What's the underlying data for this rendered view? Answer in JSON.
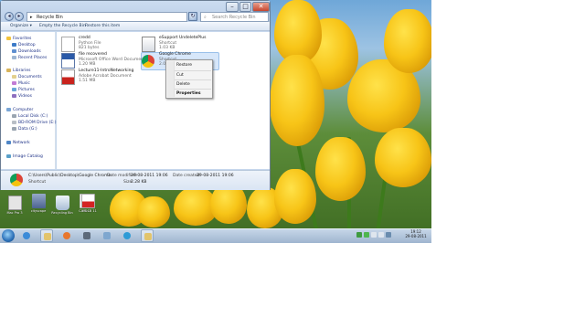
{
  "window": {
    "address": "Recycle Bin",
    "address_arrow": "▸",
    "search_placeholder": "Search Recycle Bin",
    "caption_minimize": "–",
    "caption_maximize": "□",
    "caption_close": "✕"
  },
  "toolbar": {
    "organize": "Organize ▾",
    "empty": "Empty the Recycle Bin",
    "restore": "Restore this item"
  },
  "navpane": {
    "favorites": "Favorites",
    "desktop": "Desktop",
    "downloads": "Downloads",
    "recent": "Recent Places",
    "libraries": "Libraries",
    "documents": "Documents",
    "music": "Music",
    "pictures": "Pictures",
    "videos": "Videos",
    "computer": "Computer",
    "local_disk": "Local Disk (C:)",
    "bdrom": "BD-ROM Drive (E:) 4:",
    "data": "Data (G:)",
    "network": "Network",
    "image_catalog": "Image Catalog"
  },
  "files": [
    {
      "name": "credd",
      "type": "Python File",
      "size": "821 bytes"
    },
    {
      "name": "eSupport UndeletePlus",
      "type": "Shortcut",
      "size": "1.03 KB"
    },
    {
      "name": "file recovered",
      "type": "Microsoft Office Word Document",
      "size": "1.20 MB"
    },
    {
      "name": "Google Chrome",
      "type": "Shortcut",
      "size": "2.00"
    },
    {
      "name": "Lecture11-IntroNetworking",
      "type": "Adobe Acrobat Document",
      "size": "1.51 MB"
    }
  ],
  "context_menu": {
    "restore": "Restore",
    "cut": "Cut",
    "delete": "Delete",
    "properties": "Properties"
  },
  "details": {
    "path": "C:\\Users\\Public\\Desktop\\Google Chrome",
    "type": "Shortcut",
    "date_modified_label": "Date modified:",
    "date_modified": "29-08-2011 19:06",
    "size_label": "Size:",
    "size": "2.28 KB",
    "date_created_label": "Date created:",
    "date_created": "29-08-2011 19:06"
  },
  "desktop_icons": [
    {
      "label": "Mac Pro 3",
      "color": "#d9d9d9"
    },
    {
      "label": "cityscape",
      "color": "#7a8fb3"
    },
    {
      "label": "Recycling Bin",
      "color": "#c8d6e6"
    },
    {
      "label": "IPEC",
      "color": "#ffffff"
    },
    {
      "label": "CA & LB 11",
      "color": "#d32323"
    }
  ],
  "tray": {
    "time": "19:12",
    "date": "29-08-2011"
  },
  "colors": {
    "accent": "#1e3287",
    "window_frame": "#c6d7ec",
    "selection": "#d7e7fa",
    "taskbar": "#9fb5cf"
  }
}
